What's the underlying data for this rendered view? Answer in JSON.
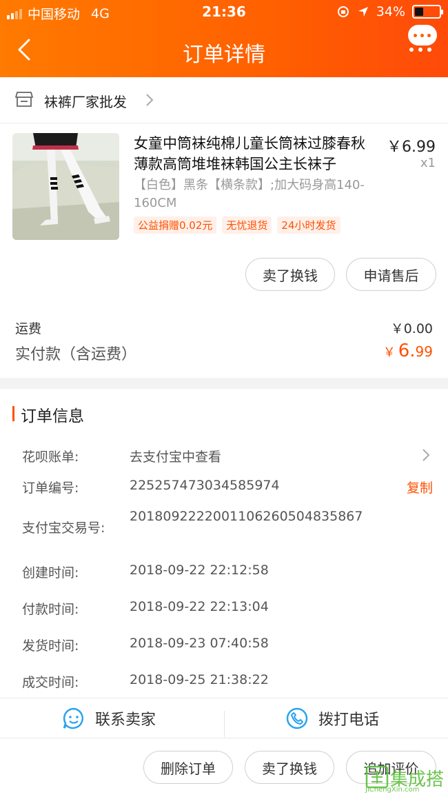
{
  "status_bar": {
    "carrier": "中国移动",
    "network": "4G",
    "time": "21:36",
    "battery": "34%",
    "battery_level": 0.34
  },
  "header": {
    "title": "订单详情",
    "back_icon": "chevron-left-icon",
    "more_icon": "chat-more-icon"
  },
  "shop": {
    "name": "袜裤厂家批发",
    "icon": "store-icon"
  },
  "product": {
    "title": "女童中筒袜纯棉儿童长筒袜过膝春秋薄款高筒堆堆袜韩国公主长袜子",
    "price": "￥6.99",
    "quantity": "x1",
    "sku": "【白色】黑条【横条款】;加大码身高140-160CM",
    "tags": [
      "公益捐赠0.02元",
      "无忧退货",
      "24小时发货"
    ]
  },
  "item_buttons": {
    "resell": "卖了换钱",
    "after_sale": "申请售后"
  },
  "totals": {
    "shipping_label": "运费",
    "shipping_value": "￥0.00",
    "paid_label": "实付款（含运费）",
    "paid_currency": "￥",
    "paid_int": "6.",
    "paid_dec": "99"
  },
  "order_info": {
    "title": "订单信息",
    "rows": [
      {
        "label": "花呗账单:",
        "value": "去支付宝中查看"
      },
      {
        "label": "订单编号:",
        "value": "225257473034585974",
        "action": "复制"
      },
      {
        "label": "支付宝交易号:",
        "value": "2018092222001106260504835867"
      },
      {
        "label": "创建时间:",
        "value": "2018-09-22 22:12:58"
      },
      {
        "label": "付款时间:",
        "value": "2018-09-22 22:13:04"
      },
      {
        "label": "发货时间:",
        "value": "2018-09-23 07:40:58"
      },
      {
        "label": "成交时间:",
        "value": "2018-09-25 21:38:22"
      }
    ]
  },
  "contact": {
    "seller": "联系卖家",
    "phone": "拨打电话"
  },
  "actions": {
    "delete": "删除订单",
    "resell": "卖了换钱",
    "review": "追加评价"
  },
  "watermark": {
    "text": "集成搭",
    "sub": "JiChengXin.com"
  },
  "colors": {
    "accent": "#ff5000",
    "header_start": "#ff7a00",
    "header_end": "#ff4a0a",
    "icon_blue": "#2aa3ef"
  }
}
